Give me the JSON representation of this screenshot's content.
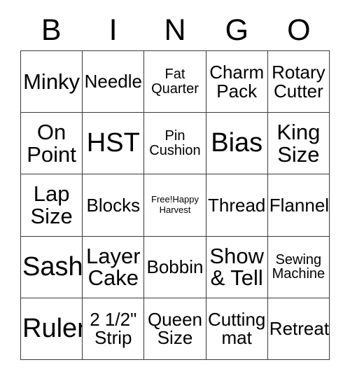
{
  "header": {
    "letters": [
      "B",
      "I",
      "N",
      "G",
      "O"
    ]
  },
  "grid": {
    "rows": 5,
    "columns": 5,
    "border_color": "#3a3a3a",
    "background_color": "#ffffff",
    "text_color": "#000000",
    "cells": [
      {
        "text": "Minky",
        "size": "lg",
        "free": false
      },
      {
        "text": "Needle",
        "size": "md",
        "free": false
      },
      {
        "text": "Fat\nQuarter",
        "size": "sm",
        "free": false
      },
      {
        "text": "Charm\nPack",
        "size": "md",
        "free": false
      },
      {
        "text": "Rotary\nCutter",
        "size": "md",
        "free": false
      },
      {
        "text": "On\nPoint",
        "size": "lg",
        "free": false
      },
      {
        "text": "HST",
        "size": "xl",
        "free": false
      },
      {
        "text": "Pin\nCushion",
        "size": "sm",
        "free": false
      },
      {
        "text": "Bias",
        "size": "xl",
        "free": false
      },
      {
        "text": "King\nSize",
        "size": "lg",
        "free": false
      },
      {
        "text": "Lap\nSize",
        "size": "lg",
        "free": false
      },
      {
        "text": "Blocks",
        "size": "md",
        "free": false
      },
      {
        "text": "Free!Happy Harvest",
        "size": "free",
        "free": true
      },
      {
        "text": "Thread",
        "size": "md",
        "free": false
      },
      {
        "text": "Flannel",
        "size": "md",
        "free": false
      },
      {
        "text": "Sash",
        "size": "xl",
        "free": false
      },
      {
        "text": "Layer\nCake",
        "size": "lg",
        "free": false
      },
      {
        "text": "Bobbin",
        "size": "md",
        "free": false
      },
      {
        "text": "Show\n& Tell",
        "size": "lg",
        "free": false
      },
      {
        "text": "Sewing\nMachine",
        "size": "sm",
        "free": false
      },
      {
        "text": "Ruler",
        "size": "xl",
        "free": false
      },
      {
        "text": "2 1/2\"\nStrip",
        "size": "md",
        "free": false
      },
      {
        "text": "Queen\nSize",
        "size": "md",
        "free": false
      },
      {
        "text": "Cutting\nmat",
        "size": "md",
        "free": false
      },
      {
        "text": "Retreat",
        "size": "md",
        "free": false
      }
    ]
  }
}
